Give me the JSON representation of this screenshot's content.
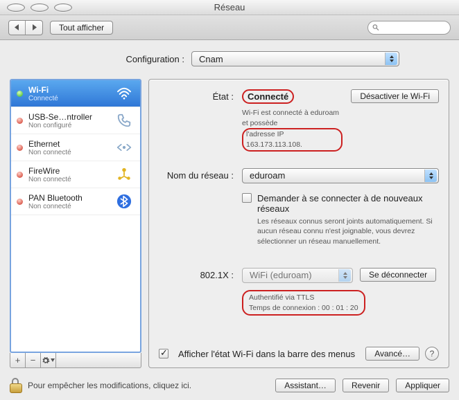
{
  "window": {
    "title": "Réseau"
  },
  "toolbar": {
    "showAll": "Tout afficher",
    "searchPlaceholder": ""
  },
  "configLabel": "Configuration :",
  "configValue": "Cnam",
  "sidebar": {
    "items": [
      {
        "name": "Wi-Fi",
        "status": "Connecté",
        "iconName": "wifi-icon",
        "dot": "green",
        "active": true
      },
      {
        "name": "USB-Se…ntroller",
        "status": "Non configuré",
        "iconName": "phone-icon",
        "dot": "red",
        "active": false
      },
      {
        "name": "Ethernet",
        "status": "Non connecté",
        "iconName": "ethernet-icon",
        "dot": "red",
        "active": false
      },
      {
        "name": "FireWire",
        "status": "Non connecté",
        "iconName": "firewire-icon",
        "dot": "red",
        "active": false
      },
      {
        "name": "PAN Bluetooth",
        "status": "Non connecté",
        "iconName": "bluetooth-icon",
        "dot": "red",
        "active": false
      }
    ]
  },
  "details": {
    "stateLabel": "État :",
    "stateValue": "Connecté",
    "toggleWifiBtn": "Désactiver le Wi-Fi",
    "stateSub1": "Wi-Fi est connecté à eduroam et possède",
    "stateSub2": "l'adresse IP 163.173.113.108.",
    "networkNameLabel": "Nom du réseau :",
    "networkNameValue": "eduroam",
    "askNewTitle": "Demander à se connecter à de nouveaux réseaux",
    "askNewDesc": "Les réseaux connus seront joints automatiquement. Si aucun réseau connu n'est joignable, vous devrez sélectionner un réseau manuellement.",
    "dot1xLabel": "802.1X :",
    "dot1xValue": "WiFi (eduroam)",
    "disconnectBtn": "Se déconnecter",
    "authLine": "Authentifié via TTLS",
    "connTimeLine": "Temps de connexion : 00 : 01 : 20",
    "showInMenu": "Afficher l'état Wi-Fi dans la barre des menus",
    "advancedBtn": "Avancé…"
  },
  "lockText": "Pour empêcher les modifications, cliquez ici.",
  "bottomButtons": {
    "assistant": "Assistant…",
    "revert": "Revenir",
    "apply": "Appliquer"
  }
}
